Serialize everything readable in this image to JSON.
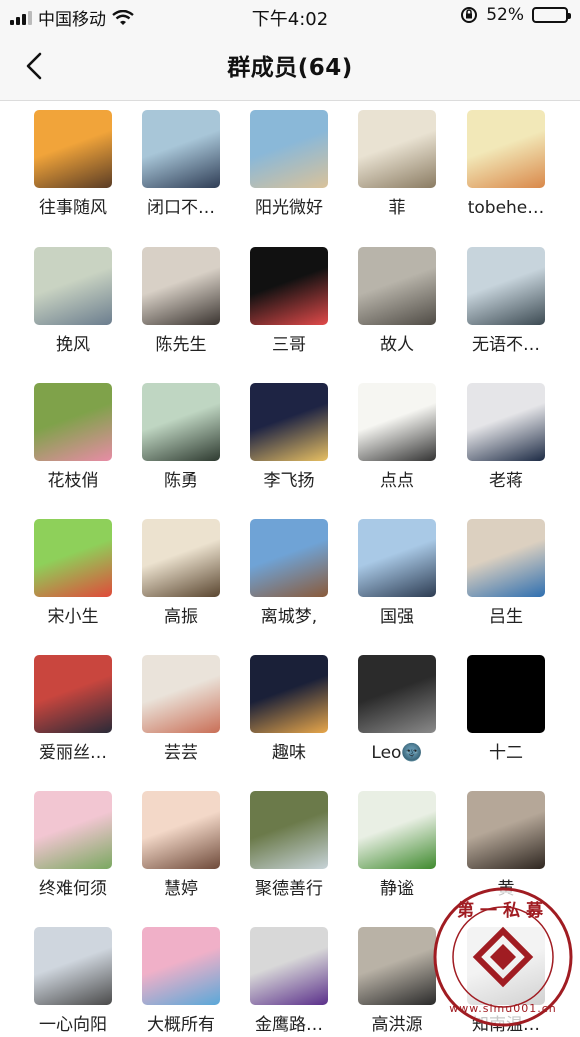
{
  "status_bar": {
    "carrier": "中国移动",
    "time": "下午4:02",
    "battery_percent": "52%",
    "battery_level": 0.52
  },
  "header": {
    "title": "群成员(64)"
  },
  "members": [
    {
      "name": "往事随风",
      "colors": [
        "#f1a43a",
        "#5a3c25"
      ]
    },
    {
      "name": "闭口不…",
      "colors": [
        "#a8c6d8",
        "#2f3d55"
      ]
    },
    {
      "name": "阳光微好",
      "colors": [
        "#8ab8d8",
        "#d9c29a"
      ]
    },
    {
      "name": "菲",
      "colors": [
        "#e9e2d2",
        "#8a7b62"
      ]
    },
    {
      "name": "tobehe…",
      "colors": [
        "#f2e8b8",
        "#d9884a"
      ]
    },
    {
      "name": "挽风",
      "colors": [
        "#c9d3c2",
        "#6b7d8e"
      ]
    },
    {
      "name": "陈先生",
      "colors": [
        "#d8d0c6",
        "#3a3430"
      ]
    },
    {
      "name": "三哥",
      "colors": [
        "#111111",
        "#e24a4a"
      ]
    },
    {
      "name": "故人",
      "colors": [
        "#b8b4aa",
        "#4f4b45"
      ]
    },
    {
      "name": "无语不…",
      "colors": [
        "#c7d4dc",
        "#3c4a52"
      ]
    },
    {
      "name": "花枝俏",
      "colors": [
        "#7fa24a",
        "#e88ca6"
      ]
    },
    {
      "name": "陈勇",
      "colors": [
        "#bfd6c2",
        "#2e3a30"
      ]
    },
    {
      "name": "李飞扬",
      "colors": [
        "#1e2444",
        "#e8c062"
      ]
    },
    {
      "name": "点点",
      "colors": [
        "#f6f6f2",
        "#333333"
      ]
    },
    {
      "name": "老蒋",
      "colors": [
        "#e5e5e8",
        "#1c2a44"
      ]
    },
    {
      "name": "宋小生",
      "colors": [
        "#8ed05a",
        "#e04a3a"
      ]
    },
    {
      "name": "高振",
      "colors": [
        "#ece2cf",
        "#5a4630"
      ]
    },
    {
      "name": "离城梦,",
      "colors": [
        "#6fa3d6",
        "#8a5a3a"
      ]
    },
    {
      "name": "国强",
      "colors": [
        "#a9c9e6",
        "#2d3c52"
      ]
    },
    {
      "name": "吕生",
      "colors": [
        "#dcd0c0",
        "#2f6fb0"
      ]
    },
    {
      "name": "爱丽丝…",
      "colors": [
        "#c9463e",
        "#2a2a38"
      ]
    },
    {
      "name": "芸芸",
      "colors": [
        "#eae3da",
        "#c96e56"
      ]
    },
    {
      "name": "趣味",
      "colors": [
        "#1a2038",
        "#e8a74a"
      ]
    },
    {
      "name": "Leo🌚",
      "colors": [
        "#2b2b2b",
        "#8a8a8a"
      ]
    },
    {
      "name": "十二",
      "colors": [
        "#000000",
        "#000000"
      ]
    },
    {
      "name": "终难何须",
      "colors": [
        "#f2c6d2",
        "#7aa860"
      ]
    },
    {
      "name": "慧婷",
      "colors": [
        "#f3d8c8",
        "#6e4a3a"
      ]
    },
    {
      "name": "聚德善行",
      "colors": [
        "#6b7a4a",
        "#c7d3d8"
      ]
    },
    {
      "name": "静谧",
      "colors": [
        "#e9efe4",
        "#3f8a2e"
      ]
    },
    {
      "name": "黄",
      "colors": [
        "#b5a798",
        "#2e2620"
      ]
    },
    {
      "name": "一心向阳",
      "colors": [
        "#cfd6de",
        "#4a4a4a"
      ]
    },
    {
      "name": "大概所有",
      "colors": [
        "#f0b0c8",
        "#5aa8d8"
      ]
    },
    {
      "name": "金鹰路…",
      "colors": [
        "#d8d8d8",
        "#5a2f8a"
      ]
    },
    {
      "name": "高洪源",
      "colors": [
        "#b9b2a6",
        "#2a2a2a"
      ]
    },
    {
      "name": "知南温…",
      "colors": [
        "#d0d0d0",
        "#4a4a4a"
      ]
    }
  ],
  "watermark": {
    "text_top": "第一私募",
    "text_bottom": "www.simu001.cn",
    "accent": "#a01c22"
  }
}
